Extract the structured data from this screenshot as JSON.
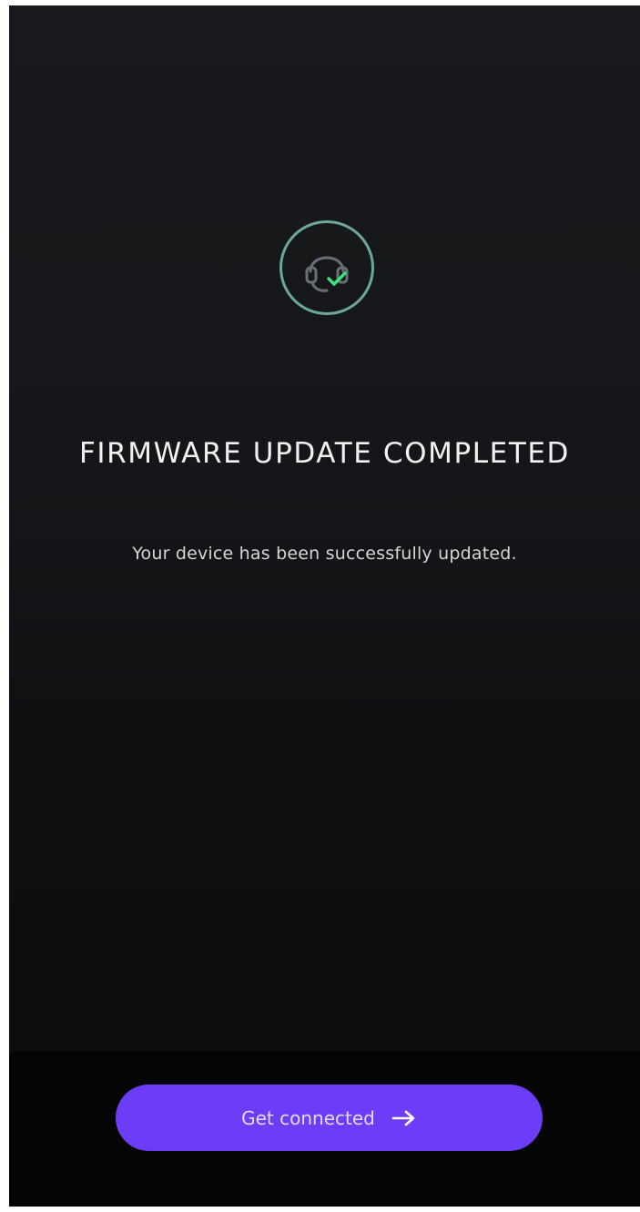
{
  "status_icon": {
    "name": "headset-check-icon",
    "ring_color": "#6fa69c",
    "check_color": "#3ee07a",
    "headset_color": "#6a6f75"
  },
  "title": "FIRMWARE UPDATE COMPLETED",
  "message": "Your device has been successfully updated.",
  "cta": {
    "label": "Get connected",
    "icon": "arrow-right-icon",
    "color": "#6d3cf7"
  }
}
